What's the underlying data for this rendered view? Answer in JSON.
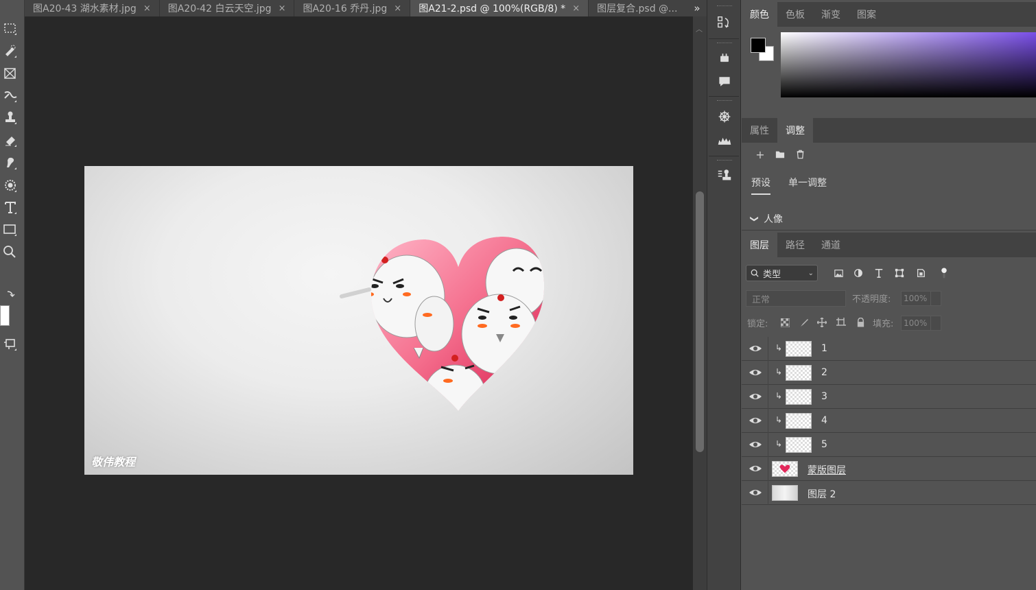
{
  "tabs": [
    {
      "label": "图A20-43 湖水素材.jpg",
      "close": "×"
    },
    {
      "label": "图A20-42 白云天空.jpg",
      "close": "×"
    },
    {
      "label": "图A20-16 乔丹.jpg",
      "close": "×"
    },
    {
      "label": "图A21-2.psd @ 100%(RGB/8) *",
      "close": "×"
    },
    {
      "label": "图层复合.psd @..."
    }
  ],
  "tab_overflow": "»",
  "document": {
    "watermark": "敬伟教程"
  },
  "color_panel": {
    "tabs": [
      "颜色",
      "色板",
      "渐变",
      "图案"
    ],
    "foreground": "#000000",
    "background": "#ffffff",
    "spectrum_hue": "#7a4fe8"
  },
  "adjust_panel": {
    "tabs": [
      "属性",
      "调整"
    ],
    "subtabs": [
      "预设",
      "单一调整"
    ],
    "preset_group": "人像"
  },
  "layers_panel": {
    "tabs": [
      "图层",
      "路径",
      "通道"
    ],
    "filter_label": "类型",
    "blend_mode": "正常",
    "opacity_label": "不透明度:",
    "opacity_value": "100%",
    "lock_label": "锁定:",
    "fill_label": "填充:",
    "fill_value": "100%",
    "layers": [
      {
        "name": "1",
        "clipped": true
      },
      {
        "name": "2",
        "clipped": true
      },
      {
        "name": "3",
        "clipped": true
      },
      {
        "name": "4",
        "clipped": true
      },
      {
        "name": "5",
        "clipped": true
      },
      {
        "name": "蒙版图层",
        "clipped": false
      },
      {
        "name": "图层 2",
        "clipped": false
      }
    ]
  }
}
